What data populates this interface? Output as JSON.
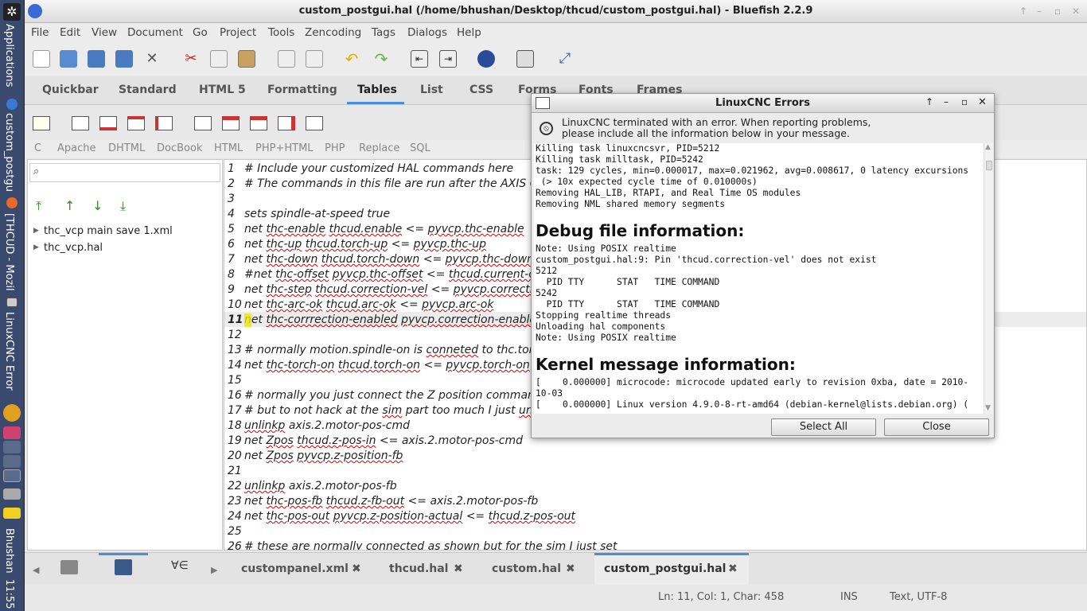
{
  "panel": {
    "applications": "Applications",
    "tasks": [
      "custom_postgu",
      "[THCUD - Mozil",
      "LinuxCNC Error"
    ],
    "user": "Bhushan",
    "clock": "11:55"
  },
  "window": {
    "title": "custom_postgui.hal (/home/bhushan/Desktop/thcud/custom_postgui.hal) - Bluefish 2.2.9"
  },
  "menubar": [
    "File",
    "Edit",
    "View",
    "Document",
    "Go",
    "Project",
    "Tools",
    "Zencoding",
    "Tags",
    "Dialogs",
    "Help"
  ],
  "quickbar_tabs": [
    "Quickbar",
    "Standard",
    "HTML 5",
    "Formatting",
    "Tables",
    "List",
    "CSS",
    "Forms",
    "Fonts",
    "Frames"
  ],
  "active_quickbar_tab": "Tables",
  "lang_tabs": [
    "C",
    "Apache",
    "DHTML",
    "DocBook",
    "HTML",
    "PHP+HTML",
    "PHP",
    "Replace",
    "SQL"
  ],
  "sidebar": {
    "files": [
      "thc_vcp main save 1.xml",
      "thc_vcp.hal"
    ]
  },
  "editor": {
    "lines": [
      {
        "n": "1",
        "text": "# Include your customized HAL commands here"
      },
      {
        "n": "2",
        "text": "# The commands in this file are run after the AXIS GU"
      },
      {
        "n": "3",
        "text": ""
      },
      {
        "n": "4",
        "text": "sets spindle-at-speed true"
      },
      {
        "n": "5",
        "text": "net thc-enable thcud.enable <= pyvcp.thc-enable"
      },
      {
        "n": "6",
        "text": "net thc-up thcud.torch-up <= pyvcp.thc-up"
      },
      {
        "n": "7",
        "text": "net thc-down thcud.torch-down <= pyvcp.thc-down"
      },
      {
        "n": "8",
        "text": "#net thc-offset pyvcp.thc-offset <= thcud.current-off"
      },
      {
        "n": "9",
        "text": "net thc-step thcud.correction-vel <= pyvcp.correction"
      },
      {
        "n": "10",
        "text": "net thc-arc-ok thcud.arc-ok <= pyvcp.arc-ok"
      },
      {
        "n": "11",
        "text": "net thc-corrrection-enabled pyvcp.correction-enabled"
      },
      {
        "n": "12",
        "text": ""
      },
      {
        "n": "13",
        "text": "# normally motion.spindle-on is conneted to thc.torch"
      },
      {
        "n": "14",
        "text": "net thc-torch-on thcud.torch-on <= pyvcp.torch-on"
      },
      {
        "n": "15",
        "text": ""
      },
      {
        "n": "16",
        "text": "# normally you just connect the Z position command"
      },
      {
        "n": "17",
        "text": "# but to not hack at the sim part too much I just unlin"
      },
      {
        "n": "18",
        "text": "unlinkp axis.2.motor-pos-cmd"
      },
      {
        "n": "19",
        "text": "net Zpos thcud.z-pos-in <= axis.2.motor-pos-cmd"
      },
      {
        "n": "20",
        "text": "net Zpos pyvcp.z-position-fb"
      },
      {
        "n": "21",
        "text": ""
      },
      {
        "n": "22",
        "text": "unlinkp axis.2.motor-pos-fb"
      },
      {
        "n": "23",
        "text": "net thc-pos-fb thcud.z-fb-out <= axis.2.motor-pos-fb"
      },
      {
        "n": "24",
        "text": "net thc-pos-out pyvcp.z-position-actual <= thcud.z-pos-out"
      },
      {
        "n": "25",
        "text": ""
      },
      {
        "n": "26",
        "text": "# these are normally connected as shown but for the sim I just set"
      }
    ]
  },
  "doc_tabs": [
    "custompanel.xml",
    "thcud.hal",
    "custom.hal",
    "custom_postgui.hal"
  ],
  "active_doc_tab": "custom_postgui.hal",
  "statusbar": {
    "position": "Ln: 11, Col: 1, Char: 458",
    "mode": "INS",
    "encoding": "Text, UTF-8"
  },
  "dialog": {
    "title": "LinuxCNC Errors",
    "message_line1": "LinuxCNC terminated with an error.  When reporting problems,",
    "message_line2": "please include all the information below in your message.",
    "log_top": [
      "Killing task linuxcncsvr, PID=5212",
      "Killing task milltask, PID=5242",
      "task: 129 cycles, min=0.000017, max=0.021962, avg=0.008617, 0 latency excursions",
      " (> 10x expected cycle time of 0.010000s)",
      "Removing HAL_LIB, RTAPI, and Real Time OS modules",
      "Removing NML shared memory segments"
    ],
    "heading_debug": "Debug file information:",
    "log_debug": [
      "Note: Using POSIX realtime",
      "custom_postgui.hal:9: Pin 'thcud.correction-vel' does not exist",
      "5212",
      "  PID TTY      STAT   TIME COMMAND",
      "5242",
      "  PID TTY      STAT   TIME COMMAND",
      "Stopping realtime threads",
      "Unloading hal components",
      "Note: Using POSIX realtime"
    ],
    "heading_kernel": "Kernel message information:",
    "log_kernel": [
      "[    0.000000] microcode: microcode updated early to revision 0xba, date = 2010-",
      "10-03",
      "[    0.000000] Linux version 4.9.0-8-rt-amd64 (debian-kernel@lists.debian.org) ("
    ],
    "select_all": "Select All",
    "close": "Close"
  }
}
